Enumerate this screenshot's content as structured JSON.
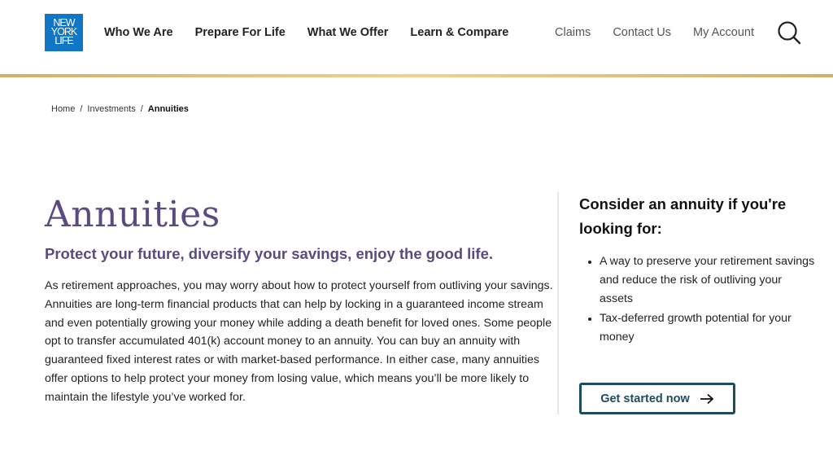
{
  "header": {
    "logo": {
      "lines": [
        "NEW",
        "YORK",
        "LIFE"
      ],
      "brand_color": "#1176c5"
    },
    "primary_nav": [
      {
        "label": "Who We Are"
      },
      {
        "label": "Prepare For Life"
      },
      {
        "label": "What We Offer"
      },
      {
        "label": "Learn & Compare"
      }
    ],
    "utility_nav": [
      {
        "label": "Claims"
      },
      {
        "label": "Contact Us"
      },
      {
        "label": "My Account"
      }
    ],
    "search_icon": "search-icon"
  },
  "breadcrumb": {
    "items": [
      "Home",
      "Investments",
      "Annuities"
    ],
    "separator": "/"
  },
  "main": {
    "title": "Annuities",
    "subtitle": "Protect your future, diversify your savings, enjoy the good life.",
    "body": "As retirement approaches, you may worry about how to protect yourself from outliving your savings. Annuities are long-term financial products that can help by locking in a guaranteed income stream and even potentially growing your money while adding a death benefit for loved ones. Some people opt to transfer accumulated 401(k) account money to an annuity. You can buy an annuity with guaranteed fixed interest rates or with market-based performance. In either case, many annuities offer options to help protect your money from losing value, which means you’ll be more likely to maintain the lifestyle you’ve worked for."
  },
  "aside": {
    "title": "Consider an annuity if you're looking for:",
    "items": [
      "A way to preserve your retirement savings and reduce the risk of outliving your assets",
      "Tax-deferred growth potential for your money"
    ],
    "cta_label": "Get started now",
    "cta_icon": "arrow-right-icon"
  },
  "colors": {
    "title_purple": "#5b4a7f",
    "cta_navy": "#1d4c61",
    "gold_accent": "#f3d08e"
  }
}
